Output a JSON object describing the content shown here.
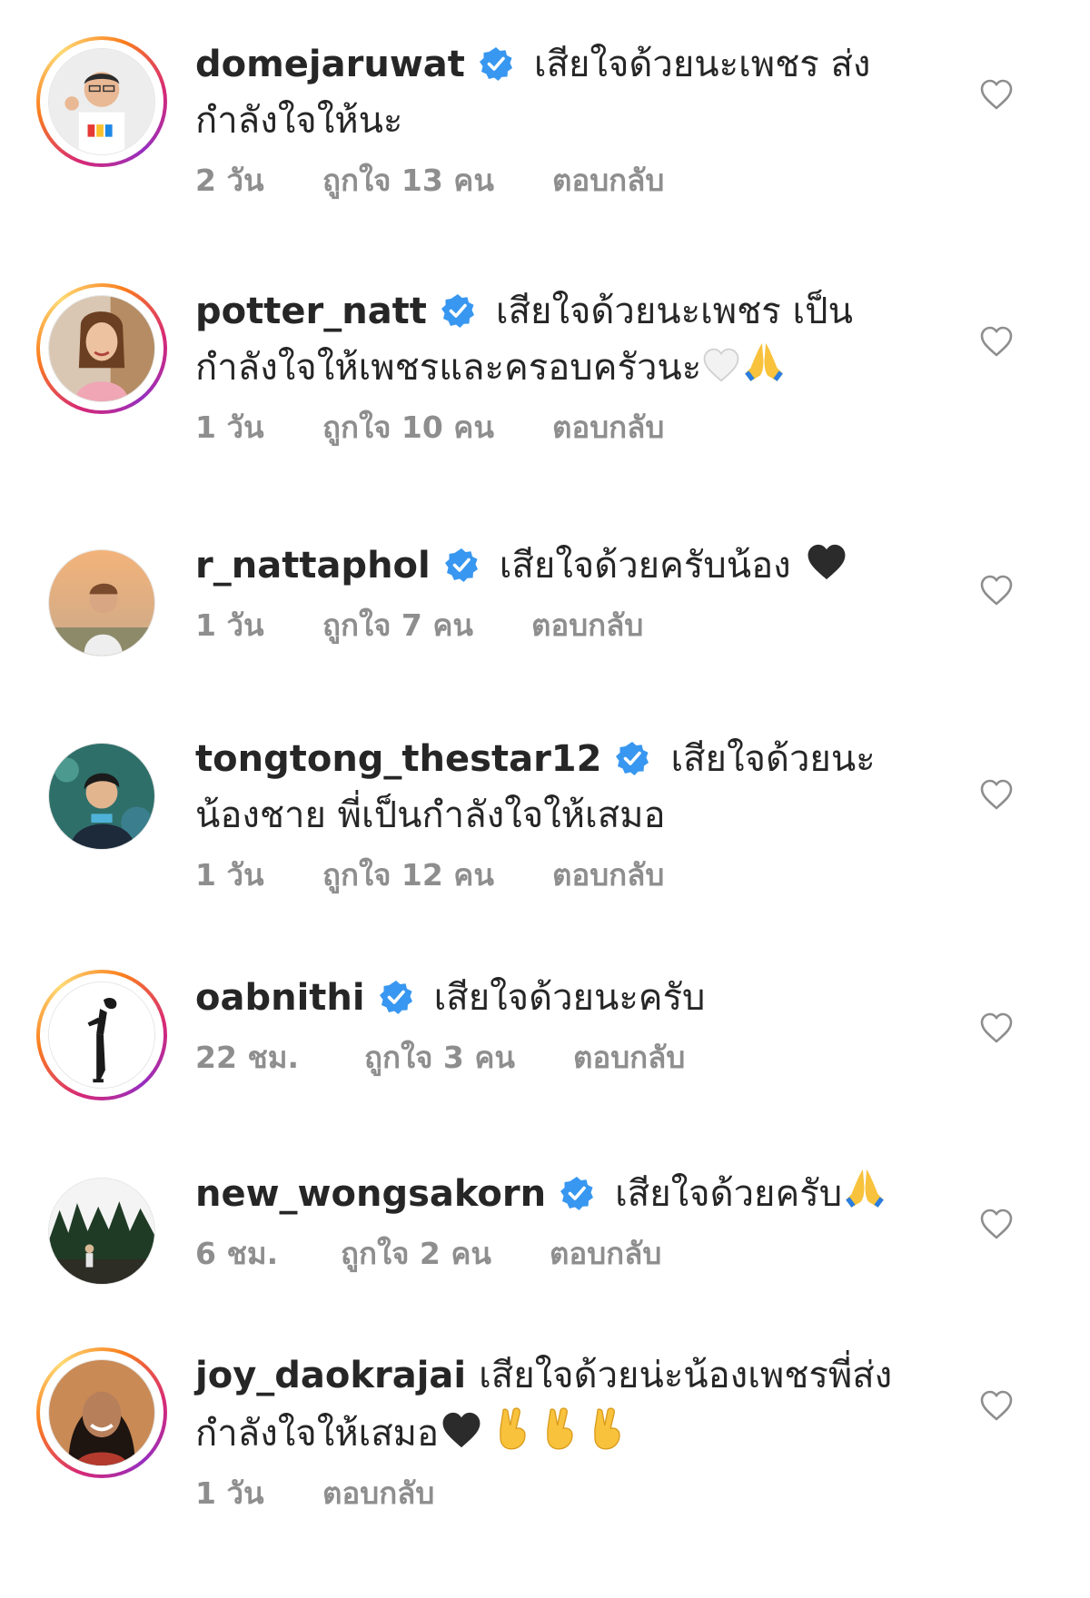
{
  "comments": [
    {
      "username": "domejaruwat",
      "text_line1": "เสียใจด้วยนะเพชร ส่ง",
      "text_line2": "กำลังใจให้นะ",
      "time": "2 วัน",
      "likes": "ถูกใจ 13 คน",
      "reply": "ตอบกลับ"
    },
    {
      "username": "potter_natt",
      "text_line1": "เสียใจด้วยนะเพชร เป็น",
      "text_line2": "กำลังใจให้เพชรและครอบครัวนะ",
      "time": "1 วัน",
      "likes": "ถูกใจ 10 คน",
      "reply": "ตอบกลับ"
    },
    {
      "username": "r_nattaphol",
      "text_line1": "เสียใจด้วยครับน้อง",
      "time": "1 วัน",
      "likes": "ถูกใจ 7 คน",
      "reply": "ตอบกลับ"
    },
    {
      "username": "tongtong_thestar12",
      "text_line1": "เสียใจด้วยนะ",
      "text_line2": "น้องชาย พี่เป็นกำลังใจให้เสมอ",
      "time": "1 วัน",
      "likes": "ถูกใจ 12 คน",
      "reply": "ตอบกลับ"
    },
    {
      "username": "oabnithi",
      "text_line1": "เสียใจด้วยนะครับ",
      "time": "22 ชม.",
      "likes": "ถูกใจ 3 คน",
      "reply": "ตอบกลับ"
    },
    {
      "username": "new_wongsakorn",
      "text_line1": "เสียใจด้วยครับ",
      "time": "6 ชม.",
      "likes": "ถูกใจ 2 คน",
      "reply": "ตอบกลับ"
    },
    {
      "username": "joy_daokrajai",
      "text_line1": "เสียใจด้วยน่ะน้องเพชรพี่ส่ง",
      "text_line2": "กำลังใจให้เสมอ",
      "time": "1 วัน",
      "reply": "ตอบกลับ"
    }
  ],
  "colors": {
    "verified_badge": "#3897f0",
    "meta_text": "#8e8e8e",
    "heart_outline": "#8e8e8e"
  },
  "icons": [
    "verified-badge-icon",
    "heart-outline-icon",
    "white-heart-emoji",
    "black-heart-emoji",
    "folded-hands-emoji",
    "victory-hand-emoji"
  ]
}
